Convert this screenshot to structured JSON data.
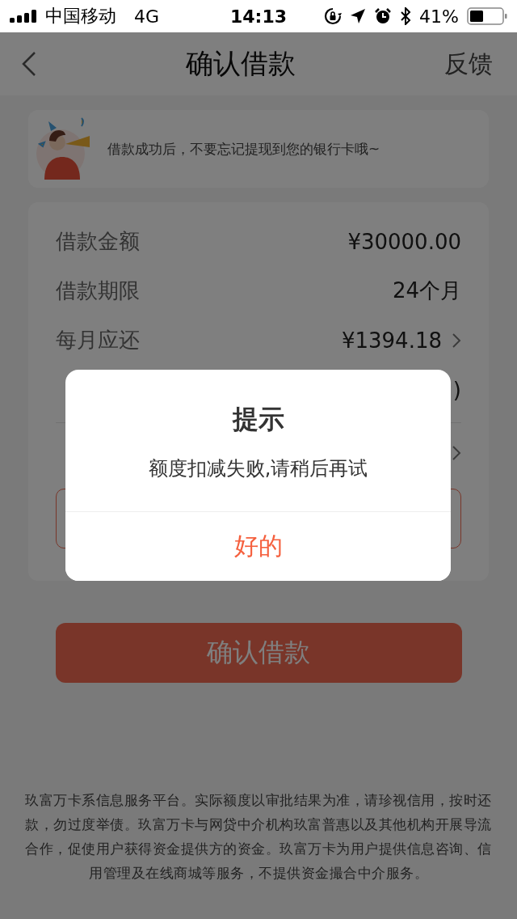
{
  "status_bar": {
    "carrier": "中国移动",
    "network": "4G",
    "time": "14:13",
    "battery": "41%"
  },
  "nav": {
    "title": "确认借款",
    "action": "反馈"
  },
  "banner": {
    "text": "借款成功后，不要忘记提现到您的银行卡哦~"
  },
  "details": [
    {
      "label": "借款金额",
      "value": "¥30000.00",
      "chevron": false,
      "divider_above": false
    },
    {
      "label": "借款期限",
      "value": "24个月",
      "chevron": false,
      "divider_above": false
    },
    {
      "label": "每月应还",
      "value": "¥1394.18",
      "chevron": true,
      "divider_above": false
    },
    {
      "value": ")",
      "chevron": false,
      "divider_above": false
    },
    {
      "chevron": true,
      "divider_above": true
    }
  ],
  "confirm_button": {
    "label": "确认借款",
    "disabled": false
  },
  "footer": "玖富万卡系信息服务平台。实际额度以审批结果为准，请珍视信用，按时还款，勿过度举债。玖富万卡与网贷中介机构玖富普惠以及其他机构开展导流合作，促使用户获得资金提供方的资金。玖富万卡为用户提供信息咨询、信用管理及在线商城等服务，不提供资金撮合中介服务。",
  "dialog": {
    "title": "提示",
    "message": "额度扣减失败,请稍后再试",
    "button": "好的"
  }
}
